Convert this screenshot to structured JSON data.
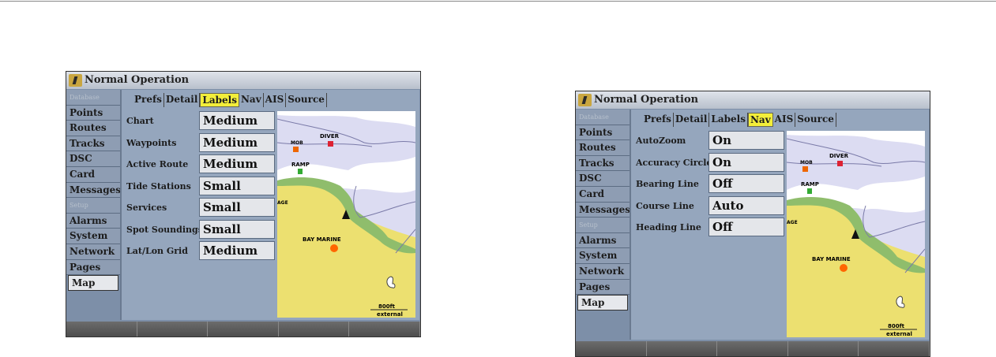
{
  "screens": [
    {
      "title": "Normal Operation",
      "sidebar": [
        {
          "label": "Database",
          "header": true
        },
        {
          "label": "Points"
        },
        {
          "label": "Routes"
        },
        {
          "label": "Tracks"
        },
        {
          "label": "DSC"
        },
        {
          "label": "Card"
        },
        {
          "label": "Messages"
        },
        {
          "label": "Setup",
          "header": true
        },
        {
          "label": "Alarms"
        },
        {
          "label": "System"
        },
        {
          "label": "Network"
        },
        {
          "label": "Pages"
        },
        {
          "label": "Map",
          "selected": true
        }
      ],
      "tabs": [
        "Prefs",
        "Detail",
        "Labels",
        "Nav",
        "AIS",
        "Source"
      ],
      "active_tab": "Labels",
      "rows": [
        {
          "label": "Chart",
          "value": "Medium"
        },
        {
          "label": "Waypoints",
          "value": "Medium"
        },
        {
          "label": "Active Route",
          "value": "Medium"
        },
        {
          "label": "Tide Stations",
          "value": "Small"
        },
        {
          "label": "Services",
          "value": "Small"
        },
        {
          "label": "Spot Soundings",
          "value": "Small"
        },
        {
          "label": "Lat/Lon Grid",
          "value": "Medium"
        }
      ]
    },
    {
      "title": "Normal Operation",
      "sidebar": [
        {
          "label": "Database",
          "header": true
        },
        {
          "label": "Points"
        },
        {
          "label": "Routes"
        },
        {
          "label": "Tracks"
        },
        {
          "label": "DSC"
        },
        {
          "label": "Card"
        },
        {
          "label": "Messages"
        },
        {
          "label": "Setup",
          "header": true
        },
        {
          "label": "Alarms"
        },
        {
          "label": "System"
        },
        {
          "label": "Network"
        },
        {
          "label": "Pages"
        },
        {
          "label": "Map",
          "selected": true
        }
      ],
      "tabs": [
        "Prefs",
        "Detail",
        "Labels",
        "Nav",
        "AIS",
        "Source"
      ],
      "active_tab": "Nav",
      "rows": [
        {
          "label": "AutoZoom",
          "value": "On"
        },
        {
          "label": "Accuracy Circle",
          "value": "On"
        },
        {
          "label": "Bearing Line",
          "value": "Off"
        },
        {
          "label": "Course Line",
          "value": "Auto"
        },
        {
          "label": "Heading Line",
          "value": "Off"
        }
      ]
    }
  ],
  "map": {
    "labels": {
      "diver": "DIVER",
      "mob": "MOB",
      "ramp": "RAMP",
      "bay_marine": "BAY MARINE",
      "age": "AGE"
    },
    "scale": "800ft",
    "scale_mode": "external",
    "colors": {
      "water": "#dcdcf2",
      "shallow": "#ffffff",
      "land": "#ece070",
      "shore": "#8fbd6c",
      "highlight": "#f3ee3a"
    }
  }
}
